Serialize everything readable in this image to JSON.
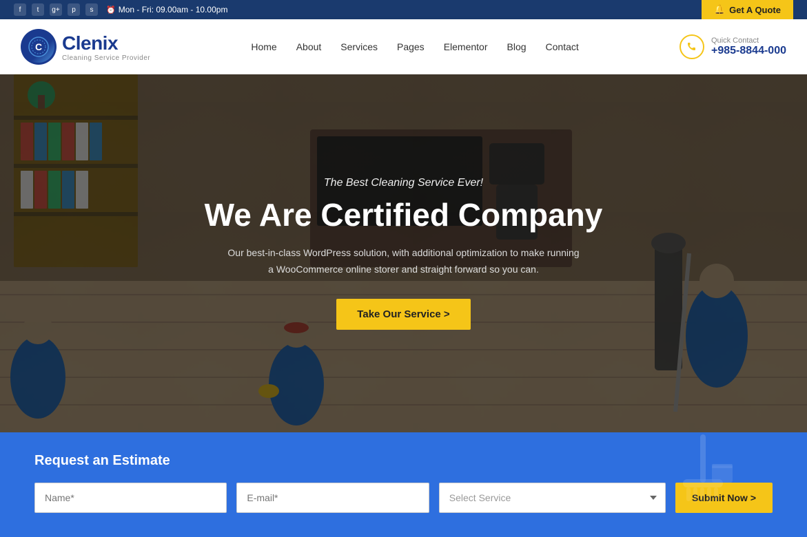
{
  "topbar": {
    "social": [
      "f",
      "t",
      "g+",
      "p",
      "s"
    ],
    "time_icon": "⏰",
    "time_text": "Mon - Fri: 09.00am - 10.00pm",
    "quote_icon": "🔔",
    "quote_label": "Get A Quote"
  },
  "header": {
    "logo_name": "Clenix",
    "logo_sub": "Cleaning Service Provider",
    "nav_items": [
      {
        "label": "Home",
        "active": false
      },
      {
        "label": "About",
        "active": false
      },
      {
        "label": "Services",
        "active": false
      },
      {
        "label": "Pages",
        "active": false
      },
      {
        "label": "Elementor",
        "active": false
      },
      {
        "label": "Blog",
        "active": false
      },
      {
        "label": "Contact",
        "active": false
      }
    ],
    "quick_contact_label": "Quick Contact",
    "phone": "+985-8844-000"
  },
  "hero": {
    "subtitle": "The Best Cleaning Service Ever!",
    "title": "We Are Certified Company",
    "description": "Our best-in-class WordPress solution, with additional optimization to make running a WooCommerce online storer and straight forward so you can.",
    "cta_label": "Take Our Service  >"
  },
  "estimate": {
    "title": "Request an Estimate",
    "name_placeholder": "Name*",
    "email_placeholder": "E-mail*",
    "service_placeholder": "Select Service",
    "submit_label": "Submit Now  >"
  }
}
